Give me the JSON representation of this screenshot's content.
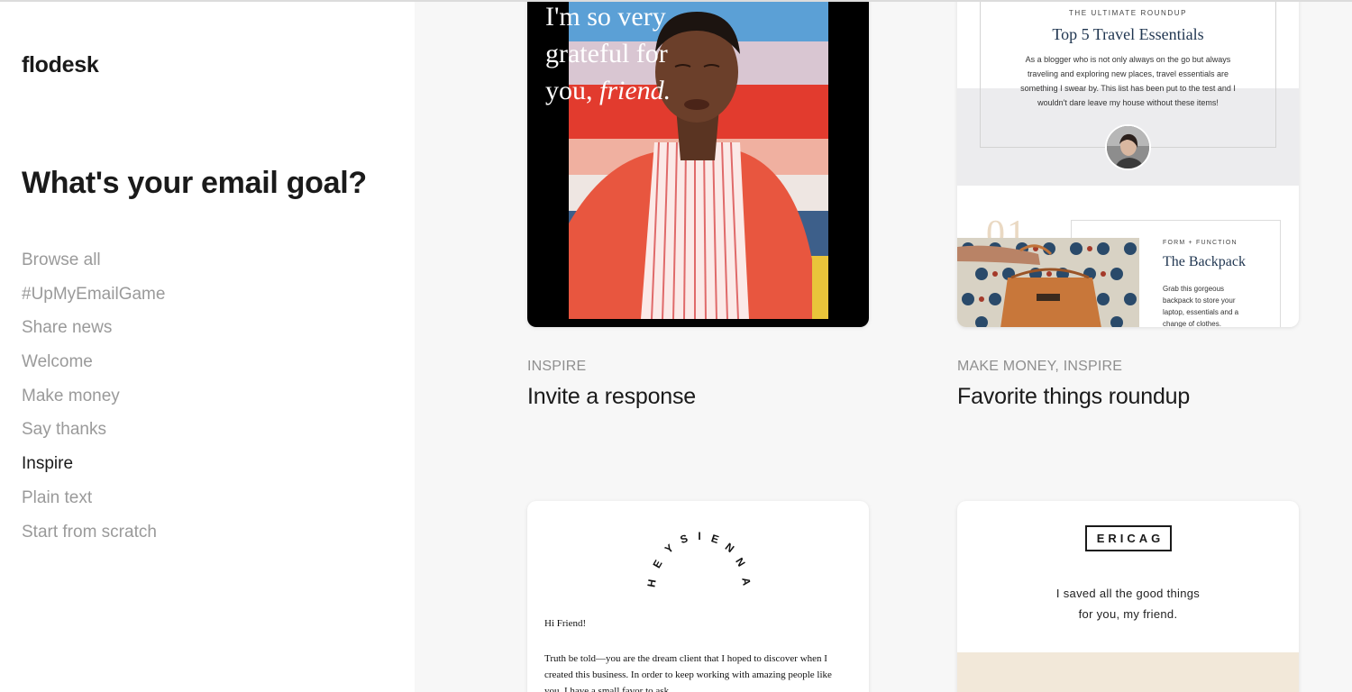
{
  "sidebar": {
    "logo": "flodesk",
    "title": "What's your email goal?",
    "nav": [
      "Browse all",
      "#UpMyEmailGame",
      "Share news",
      "Welcome",
      "Make money",
      "Say thanks",
      "Inspire",
      "Plain text",
      "Start from scratch"
    ],
    "active_item": "Inspire"
  },
  "templates": [
    {
      "category": "INSPIRE",
      "title": "Invite a response",
      "preview": {
        "headline_line1": "I'm so very",
        "headline_line2": "grateful for",
        "headline_line3": "you,",
        "headline_italic": "friend."
      }
    },
    {
      "category": "MAKE MONEY, INSPIRE",
      "title": "Favorite things roundup",
      "preview": {
        "kicker": "THE ULTIMATE ROUNDUP",
        "heading": "Top 5 Travel Essentials",
        "body": "As a blogger who is not only always on the go but always traveling and exploring new places, travel essentials are something I swear by. This list has been put to the test and I wouldn't dare leave my house without these items!",
        "item_number": "01",
        "item_kicker": "FORM + FUNCTION",
        "item_heading": "The Backpack",
        "item_body": "Grab this gorgeous backpack to store your laptop, essentials and a change of clothes."
      }
    },
    {
      "preview": {
        "logo_text": "HEYSIENNA",
        "greeting": "Hi Friend!",
        "body": "Truth be told—you are the dream client that I hoped to discover when I created this business. In order to keep working with amazing people like you, I have a small favor to ask."
      }
    },
    {
      "preview": {
        "logo_text": "ERICAG",
        "line1": "I saved all the good things",
        "line2": "for you, my friend."
      }
    }
  ],
  "colors": {
    "accent_text": "#1a1a1a",
    "muted_text": "#9a9a9a",
    "serif_heading": "#1f3550",
    "page_bg": "#f7f7f7"
  }
}
